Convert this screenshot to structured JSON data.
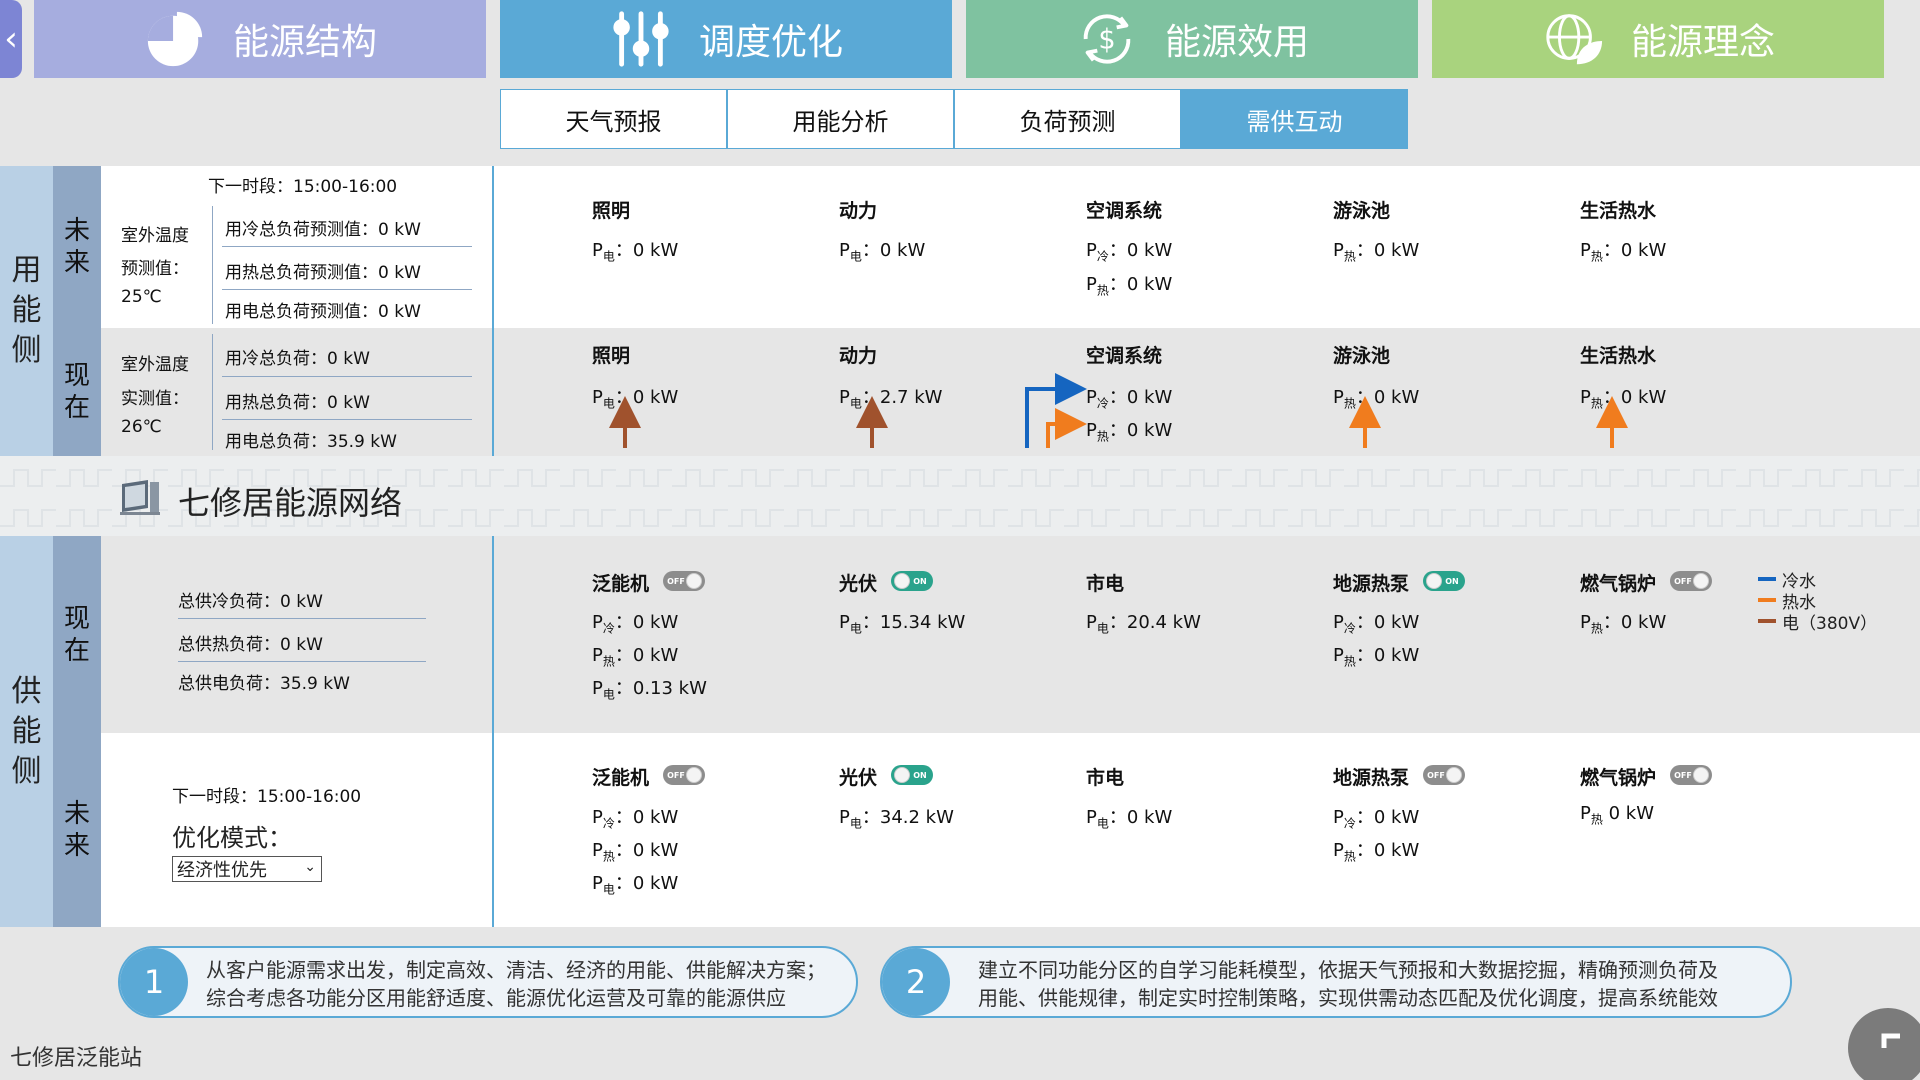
{
  "nav": {
    "back_icon": "chevron-left-icon",
    "tabs": [
      {
        "label": "能源结构",
        "color": "#a6addf",
        "icon": "pie-chart-icon"
      },
      {
        "label": "调度优化",
        "color": "#5aa9d6",
        "icon": "sliders-icon"
      },
      {
        "label": "能源效用",
        "color": "#7fc2a0",
        "icon": "dollar-cycle-icon"
      },
      {
        "label": "能源理念",
        "color": "#a9d37e",
        "icon": "globe-leaf-icon"
      }
    ]
  },
  "subtabs": [
    "天气预报",
    "用能分析",
    "负荷预测",
    "需供互动"
  ],
  "side": {
    "demand": "用能侧",
    "supply": "供能侧",
    "future": "未来",
    "now": "现在"
  },
  "demand_future": {
    "period": "下一时段：15:00-16:00",
    "temp_l1": "室外温度",
    "temp_l2": "预测值：",
    "temp_val": "25℃",
    "loads": [
      "用冷总负荷预测值：0 kW",
      "用热总负荷预测值：0 kW",
      "用电总负荷预测值：0 kW"
    ]
  },
  "demand_now": {
    "temp_l1": "室外温度",
    "temp_l2": "实测值：",
    "temp_val": "26℃",
    "loads": [
      "用冷总负荷：0 kW",
      "用热总负荷：0 kW",
      "用电总负荷：35.9 kW"
    ]
  },
  "demand_future_items": [
    {
      "name": "照明",
      "lines": [
        {
          "p": "P",
          "s": "电",
          "v": "：0 kW"
        }
      ]
    },
    {
      "name": "动力",
      "lines": [
        {
          "p": "P",
          "s": "电",
          "v": "：0 kW"
        }
      ]
    },
    {
      "name": "空调系统",
      "lines": [
        {
          "p": "P",
          "s": "冷",
          "v": "：0 kW"
        },
        {
          "p": "P",
          "s": "热",
          "v": "：0 kW"
        }
      ]
    },
    {
      "name": "游泳池",
      "lines": [
        {
          "p": "P",
          "s": "热",
          "v": "：0 kW"
        }
      ]
    },
    {
      "name": "生活热水",
      "lines": [
        {
          "p": "P",
          "s": "热",
          "v": "：0 kW"
        }
      ]
    }
  ],
  "demand_now_items": [
    {
      "name": "照明",
      "lines": [
        {
          "p": "P",
          "s": "电",
          "v": "：0 kW"
        }
      ]
    },
    {
      "name": "动力",
      "lines": [
        {
          "p": "P",
          "s": "电",
          "v": "：2.7 kW"
        }
      ]
    },
    {
      "name": "空调系统",
      "lines": [
        {
          "p": "P",
          "s": "冷",
          "v": "：0 kW"
        },
        {
          "p": "P",
          "s": "热",
          "v": "：0 kW"
        }
      ]
    },
    {
      "name": "游泳池",
      "lines": [
        {
          "p": "P",
          "s": "热",
          "v": "：0 kW"
        }
      ]
    },
    {
      "name": "生活热水",
      "lines": [
        {
          "p": "P",
          "s": "热",
          "v": "：0 kW"
        }
      ]
    }
  ],
  "network": {
    "title": "七修居能源网络",
    "icon": "computer-icon"
  },
  "supply_now": {
    "loads": [
      "总供冷负荷：0 kW",
      "总供热负荷：0 kW",
      "总供电负荷：35.9 kW"
    ]
  },
  "supply_now_items": [
    {
      "name": "泛能机",
      "toggle": "OFF",
      "lines": [
        {
          "p": "P",
          "s": "冷",
          "v": "：0 kW"
        },
        {
          "p": "P",
          "s": "热",
          "v": "：0 kW"
        },
        {
          "p": "P",
          "s": "电",
          "v": "：0.13 kW"
        }
      ]
    },
    {
      "name": "光伏",
      "toggle": "ON",
      "lines": [
        {
          "p": "P",
          "s": "电",
          "v": "：15.34 kW"
        }
      ]
    },
    {
      "name": "市电",
      "toggle": "",
      "lines": [
        {
          "p": "P",
          "s": "电",
          "v": "：20.4 kW"
        }
      ]
    },
    {
      "name": "地源热泵",
      "toggle": "ON",
      "lines": [
        {
          "p": "P",
          "s": "冷",
          "v": "：0 kW"
        },
        {
          "p": "P",
          "s": "热",
          "v": "：0 kW"
        }
      ]
    },
    {
      "name": "燃气锅炉",
      "toggle": "OFF",
      "lines": [
        {
          "p": "P",
          "s": "热",
          "v": "：0 kW"
        }
      ]
    }
  ],
  "supply_future": {
    "period": "下一时段：15:00-16:00",
    "mode_label": "优化模式：",
    "mode_value": "经济性优先"
  },
  "supply_future_items": [
    {
      "name": "泛能机",
      "toggle": "OFF",
      "lines": [
        {
          "p": "P",
          "s": "冷",
          "v": "：0 kW"
        },
        {
          "p": "P",
          "s": "热",
          "v": "：0 kW"
        },
        {
          "p": "P",
          "s": "电",
          "v": "：0 kW"
        }
      ]
    },
    {
      "name": "光伏",
      "toggle": "ON",
      "lines": [
        {
          "p": "P",
          "s": "电",
          "v": "：34.2 kW"
        }
      ]
    },
    {
      "name": "市电",
      "toggle": "",
      "lines": [
        {
          "p": "P",
          "s": "电",
          "v": "：0 kW"
        }
      ]
    },
    {
      "name": "地源热泵",
      "toggle": "OFF",
      "lines": [
        {
          "p": "P",
          "s": "冷",
          "v": "：0 kW"
        },
        {
          "p": "P",
          "s": "热",
          "v": "：0 kW"
        }
      ]
    },
    {
      "name": "燃气锅炉",
      "toggle": "OFF",
      "lines": [
        {
          "p": "P",
          "s": "热",
          "v": " 0 kW"
        }
      ]
    }
  ],
  "legend": [
    {
      "label": "冷水",
      "color": "#1565c0"
    },
    {
      "label": "热水",
      "color": "#f07c1e"
    },
    {
      "label": "电（380V）",
      "color": "#a0522d"
    }
  ],
  "colors": {
    "cold": "#1565c0",
    "hot": "#f07c1e",
    "elec": "#a0522d",
    "accent": "#5aa9d6"
  },
  "info": [
    {
      "num": "1",
      "l1": "从客户能源需求出发，制定高效、清洁、经济的用能、供能解决方案；",
      "l2": "综合考虑各功能分区用能舒适度、能源优化运营及可靠的能源供应"
    },
    {
      "num": "2",
      "l1": "建立不同功能分区的自学习能耗模型，依据天气预报和大数据挖掘，精确预测负荷及",
      "l2": "用能、供能规律，制定实时控制策略，实现供需动态匹配及优化调度，提高系统能效"
    }
  ],
  "footer": "七修居泛能站"
}
